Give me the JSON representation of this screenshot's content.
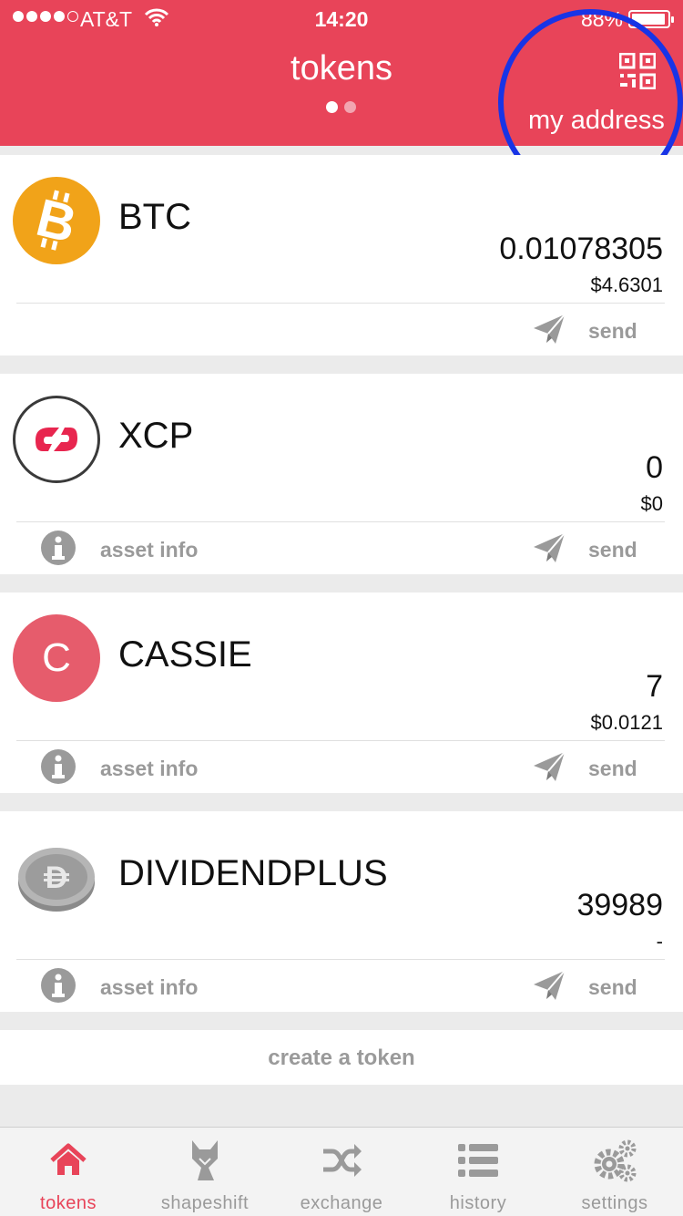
{
  "status_bar": {
    "carrier": "AT&T",
    "time": "14:20",
    "battery": "88%"
  },
  "header": {
    "title": "tokens",
    "my_address_label": "my address"
  },
  "tokens": [
    {
      "symbol": "BTC",
      "amount": "0.01078305",
      "fiat": "$4.6301",
      "send_label": "send"
    },
    {
      "symbol": "XCP",
      "amount": "0",
      "fiat": "$0",
      "info_label": "asset info",
      "send_label": "send"
    },
    {
      "symbol": "CASSIE",
      "letter": "C",
      "amount": "7",
      "fiat": "$0.0121",
      "info_label": "asset info",
      "send_label": "send"
    },
    {
      "symbol": "DIVIDENDPLUS",
      "amount": "39989",
      "fiat": "-",
      "info_label": "asset info",
      "send_label": "send"
    }
  ],
  "create_token_label": "create a token",
  "tab_bar": {
    "tabs": [
      {
        "label": "tokens",
        "icon": "home-icon",
        "active": true
      },
      {
        "label": "shapeshift",
        "icon": "fox-icon",
        "active": false
      },
      {
        "label": "exchange",
        "icon": "shuffle-icon",
        "active": false
      },
      {
        "label": "history",
        "icon": "list-icon",
        "active": false
      },
      {
        "label": "settings",
        "icon": "gears-icon",
        "active": false
      }
    ]
  },
  "colors": {
    "brand": "#e84459",
    "highlight_ring": "#1834e6",
    "btc": "#f1a319",
    "cassie": "#e65c6c",
    "muted": "#9a9a9a"
  }
}
